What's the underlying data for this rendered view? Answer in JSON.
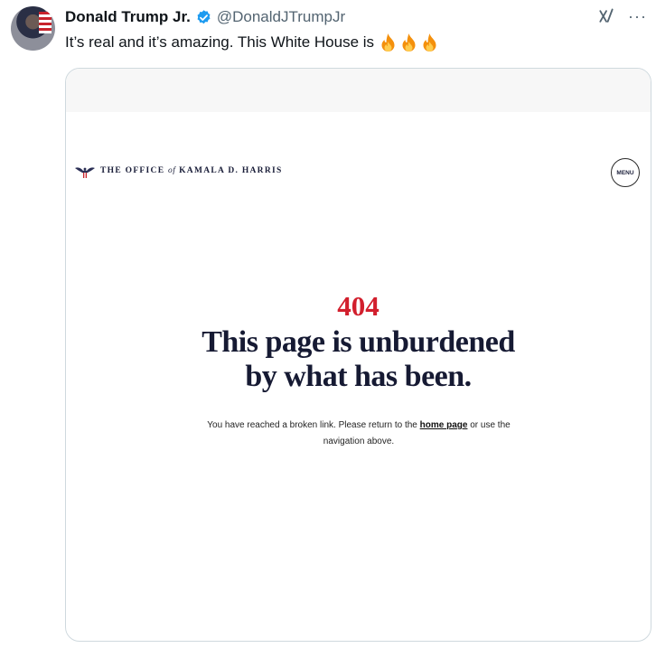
{
  "tweet": {
    "author_name": "Donald Trump Jr.",
    "handle": "@DonaldJTrumpJr",
    "text": "It’s real and it’s amazing. This White House is",
    "emojis": [
      "fire-emoji",
      "fire-emoji",
      "fire-emoji"
    ],
    "more_label": "···",
    "verified_color": "#1d9bf0"
  },
  "screenshot": {
    "site_title_prefix": "THE OFFICE",
    "site_title_of": "of",
    "site_title_suffix": "KAMALA D. HARRIS",
    "menu_label": "MENU",
    "error_code": "404",
    "headline_line1": "This page is unburdened",
    "headline_line2": "by what has been.",
    "desc_before": "You have reached a broken link. Please return to the",
    "home_link": "home page",
    "desc_after": "or use the navigation above.",
    "accent_color": "#d21f2d"
  }
}
